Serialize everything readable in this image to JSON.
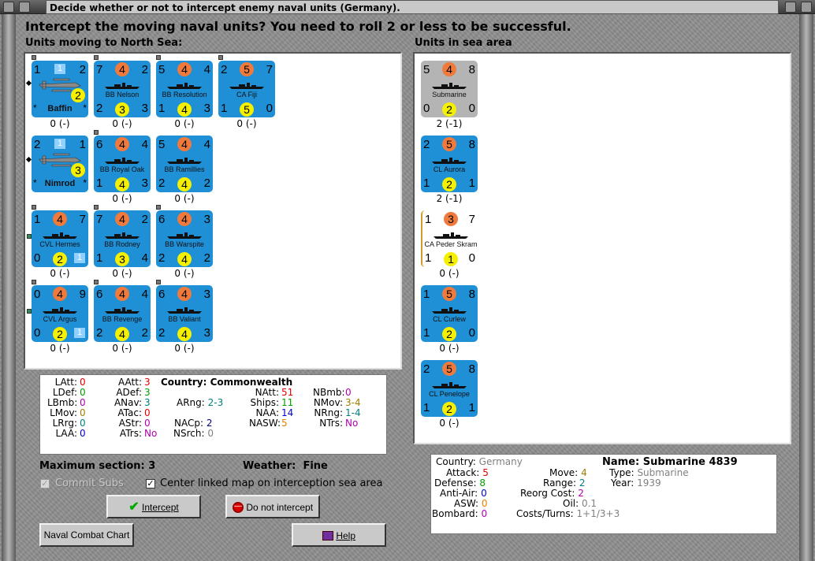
{
  "window": {
    "title": "Decide whether or not to intercept enemy naval units (Germany)."
  },
  "question": "Intercept the moving naval units?  You need to roll 2 or less to be successful.",
  "moving_label": "Units moving to North Sea:",
  "sea_label": "Units in sea area",
  "moving_units": [
    {
      "name": "Baffin",
      "tl": "1",
      "tr": "2",
      "bl": "*",
      "br": "*",
      "sq_top": "1",
      "circ": "2",
      "sub": "0 (-)",
      "plane": true
    },
    {
      "name": "BB Nelson",
      "tl": "7",
      "orange": "4",
      "tr": "2",
      "bl": "2",
      "yellow": "3",
      "br": "3",
      "sub": "0 (-)"
    },
    {
      "name": "BB Resolution",
      "tl": "5",
      "orange": "4",
      "tr": "4",
      "bl": "1",
      "yellow": "4",
      "br": "3",
      "sub": "0 (-)"
    },
    {
      "name": "CA Fiji",
      "tl": "2",
      "orange": "5",
      "tr": "7",
      "bl": "1",
      "yellow": "5",
      "br": "0",
      "sub": "0 (-)"
    },
    {
      "name": "Nimrod",
      "tl": "2",
      "tr": "1",
      "bl": "*",
      "br": "*",
      "sq_top": "1",
      "circ": "3",
      "sub": "",
      "plane": true
    },
    {
      "name": "BB Royal Oak",
      "tl": "6",
      "orange": "4",
      "tr": "4",
      "bl": "1",
      "yellow": "4",
      "br": "3",
      "sub": "0 (-)"
    },
    {
      "name": "BB Ramillies",
      "tl": "5",
      "orange": "4",
      "tr": "4",
      "bl": "2",
      "yellow": "4",
      "br": "2",
      "sub": "0 (-)"
    },
    {
      "name": "CVL Hermes",
      "tl": "1",
      "orange": "4",
      "tr": "7",
      "bl": "0",
      "yellow": "2",
      "br": "1",
      "sq": true,
      "sub": "0 (-)"
    },
    {
      "name": "BB Rodney",
      "tl": "7",
      "orange": "4",
      "tr": "2",
      "bl": "1",
      "yellow": "3",
      "br": "4",
      "sub": "0 (-)"
    },
    {
      "name": "BB Warspite",
      "tl": "6",
      "orange": "4",
      "tr": "3",
      "bl": "2",
      "yellow": "4",
      "br": "2",
      "sub": "0 (-)"
    },
    {
      "name": "CVL Argus",
      "tl": "0",
      "orange": "4",
      "tr": "9",
      "bl": "0",
      "yellow": "2",
      "br": "1",
      "sq": true,
      "sub": "0 (-)"
    },
    {
      "name": "BB Revenge",
      "tl": "6",
      "orange": "4",
      "tr": "4",
      "bl": "2",
      "yellow": "4",
      "br": "2",
      "sub": "0 (-)"
    },
    {
      "name": "BB Valiant",
      "tl": "6",
      "orange": "4",
      "tr": "3",
      "bl": "2",
      "yellow": "4",
      "br": "3",
      "sub": "0 (-)"
    }
  ],
  "sea_units": [
    {
      "name": "Submarine",
      "tl": "5",
      "orange": "4",
      "tr": "8",
      "bl": "0",
      "yellow": "2",
      "br": "0",
      "sub": "2 (-1)",
      "style": "grey"
    },
    {
      "name": "CL Aurora",
      "tl": "2",
      "orange": "5",
      "tr": "8",
      "bl": "1",
      "yellow": "2",
      "br": "1",
      "sub": "2 (-1)"
    },
    {
      "name": "CA Peder Skram",
      "tl": "1",
      "orange": "3",
      "tr": "7",
      "bl": "1",
      "yellow": "1",
      "br": "0",
      "sub": "0 (-)",
      "style": "white"
    },
    {
      "name": "CL Curlew",
      "tl": "1",
      "orange": "5",
      "tr": "8",
      "bl": "1",
      "yellow": "2",
      "br": "0",
      "sub": "0 (-)"
    },
    {
      "name": "CL Penelope",
      "tl": "2",
      "orange": "5",
      "tr": "8",
      "bl": "1",
      "yellow": "2",
      "br": "1",
      "sub": "0 (-)"
    }
  ],
  "stats": {
    "country_label": "Country:",
    "country": "Commonwealth",
    "col1": [
      {
        "k": "LAtt:",
        "v": "0",
        "c": "red"
      },
      {
        "k": "LDef:",
        "v": "0",
        "c": "green"
      },
      {
        "k": "LBmb:",
        "v": "0",
        "c": "purple"
      },
      {
        "k": "LMov:",
        "v": "0",
        "c": "olive"
      },
      {
        "k": "LRrg:",
        "v": "0",
        "c": "teal"
      },
      {
        "k": "LAA:",
        "v": "0",
        "c": "blue"
      }
    ],
    "col2": [
      {
        "k": "AAtt:",
        "v": "3",
        "c": "red"
      },
      {
        "k": "ADef:",
        "v": "3",
        "c": "green"
      },
      {
        "k": "ANav:",
        "v": "3",
        "c": "teal"
      },
      {
        "k": "ATac:",
        "v": "0",
        "c": "red"
      },
      {
        "k": "AStr:",
        "v": "0",
        "c": "purple"
      },
      {
        "k": "ATrs:",
        "v": "No",
        "c": "purple"
      }
    ],
    "arng": {
      "k": "ARng:",
      "v": "2-3"
    },
    "nacp": {
      "k": "NACp:",
      "v": "2"
    },
    "nsrch": {
      "k": "NSrch:",
      "v": "0"
    },
    "col4": [
      {
        "k": "NAtt:",
        "v": "51",
        "c": "red"
      },
      {
        "k": "Ships:",
        "v": "11",
        "c": "green"
      },
      {
        "k": "NAA:",
        "v": "14",
        "c": "blue"
      },
      {
        "k": "NASW:",
        "v": "5",
        "c": "orange"
      }
    ],
    "col5": [
      {
        "k": "NBmb:",
        "v": "0",
        "c": "purple"
      },
      {
        "k": "NMov:",
        "v": "3-4",
        "c": "olive"
      },
      {
        "k": "NRng:",
        "v": "1-4",
        "c": "teal"
      },
      {
        "k": "NTrs:",
        "v": "No",
        "c": "purple"
      }
    ]
  },
  "max_section": "Maximum section: 3",
  "weather_label": "Weather:",
  "weather": "Fine",
  "commit_subs": "Commit Subs",
  "center_map": "Center linked map on interception sea area",
  "buttons": {
    "intercept": "Intercept",
    "no_intercept": "Do not intercept",
    "chart": "Naval Combat Chart",
    "help": "Help"
  },
  "unit_info": {
    "country_label": "Country:",
    "country": "Germany",
    "name_label": "Name:",
    "name": "Submarine 4839",
    "attack_label": "Attack:",
    "attack": "5",
    "defense_label": "Defense:",
    "defense": "8",
    "aa_label": "Anti-Air:",
    "aa": "0",
    "asw_label": "ASW:",
    "asw": "0",
    "bombard_label": "Bombard:",
    "bombard": "0",
    "move_label": "Move:",
    "move": "4",
    "range_label": "Range:",
    "range": "2",
    "reorg_label": "Reorg Cost:",
    "reorg": "2",
    "oil_label": "Oil:",
    "oil": "0.1",
    "costs_label": "Costs/Turns:",
    "costs": "1+1/3+3",
    "type_label": "Type:",
    "type": "Submarine",
    "year_label": "Year:",
    "year": "1939"
  },
  "colors": {
    "counter_blue": "#1f8fd6",
    "orange": "#f07a3c",
    "yellow": "#f5f000"
  }
}
